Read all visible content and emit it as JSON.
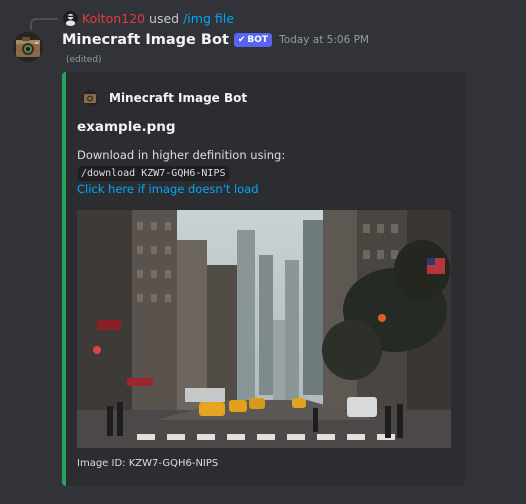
{
  "reply": {
    "username": "Kolton120",
    "used_text": "used",
    "command": "/img file"
  },
  "message": {
    "bot_name": "Minecraft Image Bot",
    "bot_tag": "BOT",
    "bot_tag_icon": "check-icon",
    "timestamp": "Today at 5:06 PM",
    "edited": "(edited)"
  },
  "embed": {
    "accent_color": "#23a55a",
    "author": "Minecraft Image Bot",
    "author_icon": "camera-icon",
    "title": "example.png",
    "description_line1": "Download in higher definition using:",
    "command_code": "/download KZW7-GQH6-NIPS",
    "link_text": "Click here if image doesn't load",
    "image": "city-street-photo",
    "footer": "Image ID: KZW7-GQH6-NIPS"
  },
  "colors": {
    "background": "#313338",
    "embed_bg": "#2b2d31",
    "link": "#00a8fc",
    "bot_tag_bg": "#5865f2",
    "username_red": "#e23c3c"
  }
}
